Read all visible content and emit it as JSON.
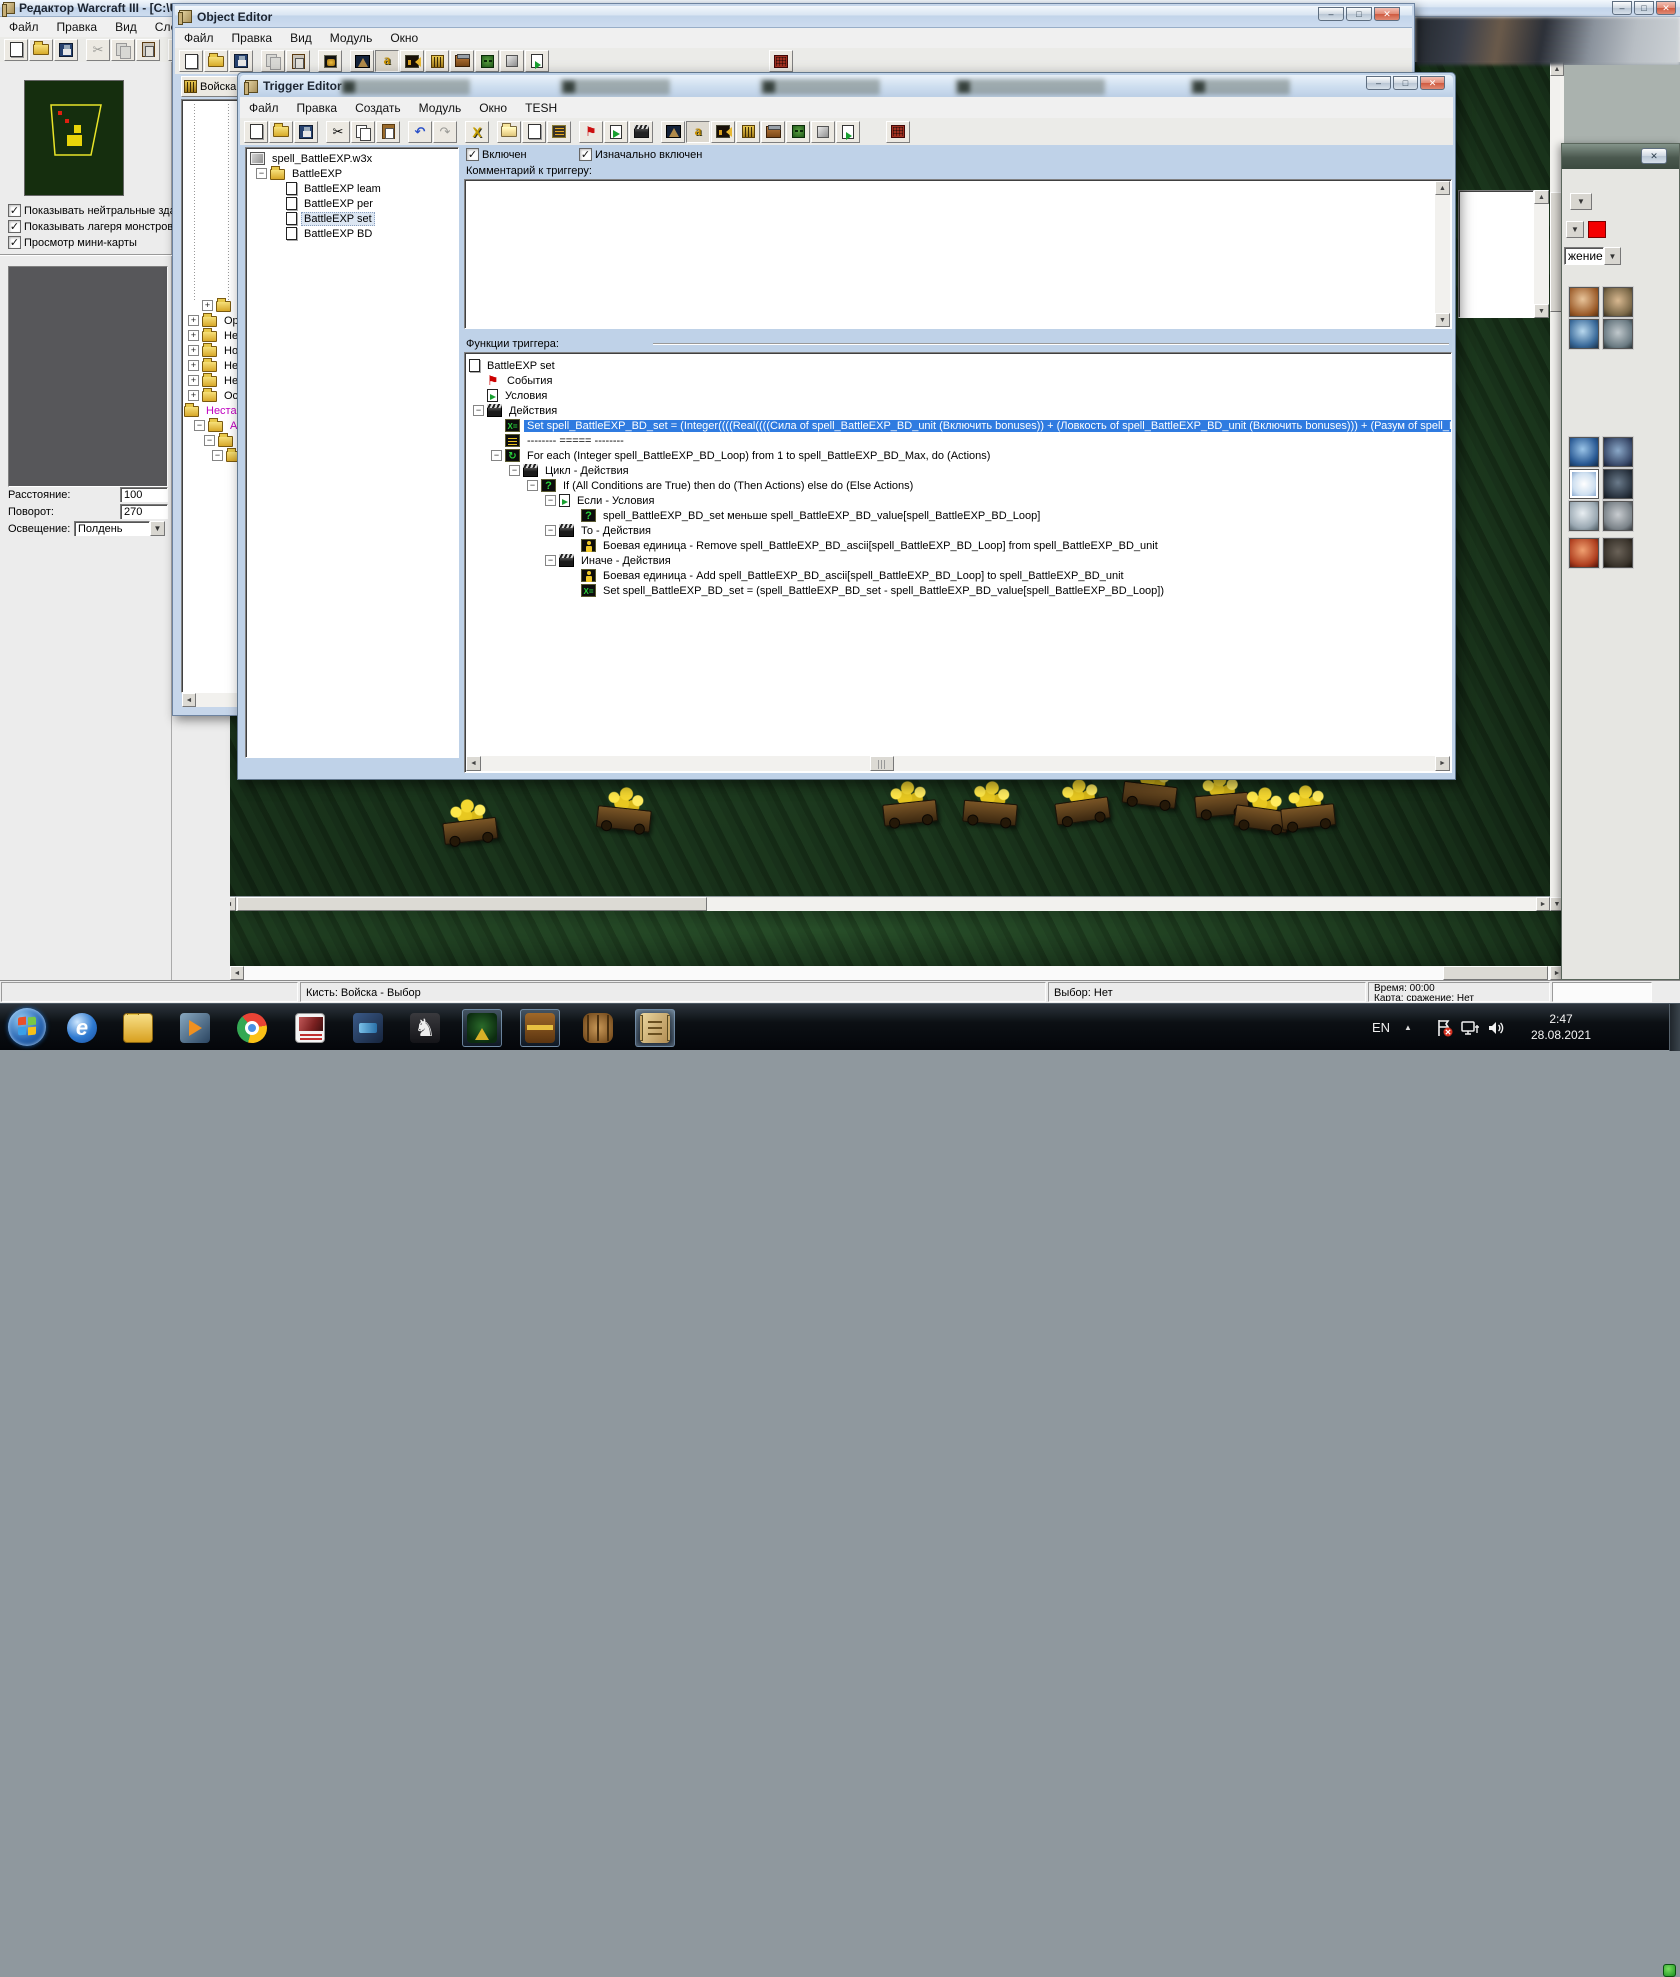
{
  "glyphs": {
    "minus": "−",
    "plus": "+",
    "check": "✓",
    "left": "◄",
    "right": "►",
    "up": "▲",
    "down": "▼",
    "min": "–",
    "max": "□",
    "close": "✕",
    "flag": "⚑",
    "cut": "✂",
    "undo": "↶",
    "redo": "↷",
    "x_delete": "X",
    "a_obj": "a",
    "e_ie": "e",
    "knight": "♞"
  },
  "main_window": {
    "title": "Редактор Warcraft III  - [C:\\Us",
    "menu": [
      "Файл",
      "Правка",
      "Вид",
      "Слой"
    ],
    "view_options": [
      {
        "label": "Показывать нейтральные зда"
      },
      {
        "label": "Показывать лагеря монстров"
      },
      {
        "label": "Просмотр мини-карты"
      }
    ],
    "fields": [
      {
        "label": "Расстояние:",
        "value": "100"
      },
      {
        "label": "Поворот:",
        "value": "270"
      },
      {
        "label": "Освещение:",
        "value": "Полдень"
      }
    ],
    "status": {
      "brush": "Кисть: Войска - Выбор",
      "selection": "Выбор: Нет",
      "time": "Время: 00:00",
      "map": "Карта: сражение: Нет"
    }
  },
  "object_editor": {
    "title": "Object Editor",
    "menu": [
      "Файл",
      "Правка",
      "Вид",
      "Модуль",
      "Окно"
    ],
    "tab": "Войска",
    "tree": [
      {
        "label": ""
      },
      {
        "label": "Орд"
      },
      {
        "label": "Неж"
      },
      {
        "label": "Ноч"
      },
      {
        "label": "Ней"
      },
      {
        "label": "Ней"
      },
      {
        "label": "Осо"
      },
      {
        "label": "Нестан"
      },
      {
        "label": "Аль"
      },
      {
        "label": ""
      },
      {
        "label": ""
      }
    ]
  },
  "trigger_editor": {
    "title": "Trigger Editor",
    "menu": [
      "Файл",
      "Правка",
      "Создать",
      "Модуль",
      "Окно",
      "TESH"
    ],
    "map_tree": {
      "root": "spell_BattleEXP.w3x",
      "folder": "BattleEXP",
      "items": [
        "BattleEXP leam",
        "BattleEXP per",
        "BattleEXP set",
        "BattleEXP BD"
      ]
    },
    "enabled_checkbox": "Включен",
    "initially_on_checkbox": "Изначально включен",
    "comment_label": "Комментарий к триггеру:",
    "functions_label": "Функции триггера:",
    "function_rows": [
      {
        "label": "BattleEXP set"
      },
      {
        "label": "События"
      },
      {
        "label": "Условия"
      },
      {
        "label": "Действия"
      },
      {
        "label": "Set spell_BattleEXP_BD_set = (Integer((((Real((((Сила of spell_BattleEXP_BD_unit (Включить bonuses)) + (Ловкость of spell_BattleEXP_BD_unit (Включить bonuses))) + (Разум of spell_BattleEXP_BD_unit (Включить bonuses)))"
      },
      {
        "label": "-------- ===== --------"
      },
      {
        "label": "For each (Integer spell_BattleEXP_BD_Loop) from 1 to spell_BattleEXP_BD_Max, do (Actions)"
      },
      {
        "label": "Цикл - Действия"
      },
      {
        "label": "If (All Conditions are True) then do (Then Actions) else do (Else Actions)"
      },
      {
        "label": "Если - Условия"
      },
      {
        "label": "spell_BattleEXP_BD_set меньше spell_BattleEXP_BD_value[spell_BattleEXP_BD_Loop]"
      },
      {
        "label": "То - Действия"
      },
      {
        "label": "Боевая единица - Remove spell_BattleEXP_BD_ascii[spell_BattleEXP_BD_Loop] from spell_BattleEXP_BD_unit"
      },
      {
        "label": "Иначе - Действия"
      },
      {
        "label": "Боевая единица - Add spell_BattleEXP_BD_ascii[spell_BattleEXP_BD_Loop] to spell_BattleEXP_BD_unit"
      },
      {
        "label": "Set spell_BattleEXP_BD_set = (spell_BattleEXP_BD_set - spell_BattleEXP_BD_value[spell_BattleEXP_BD_Loop])"
      }
    ]
  },
  "palette": {
    "combo_text": "жение"
  },
  "taskbar": {
    "lang": "EN",
    "time": "2:47",
    "date": "28.08.2021"
  }
}
